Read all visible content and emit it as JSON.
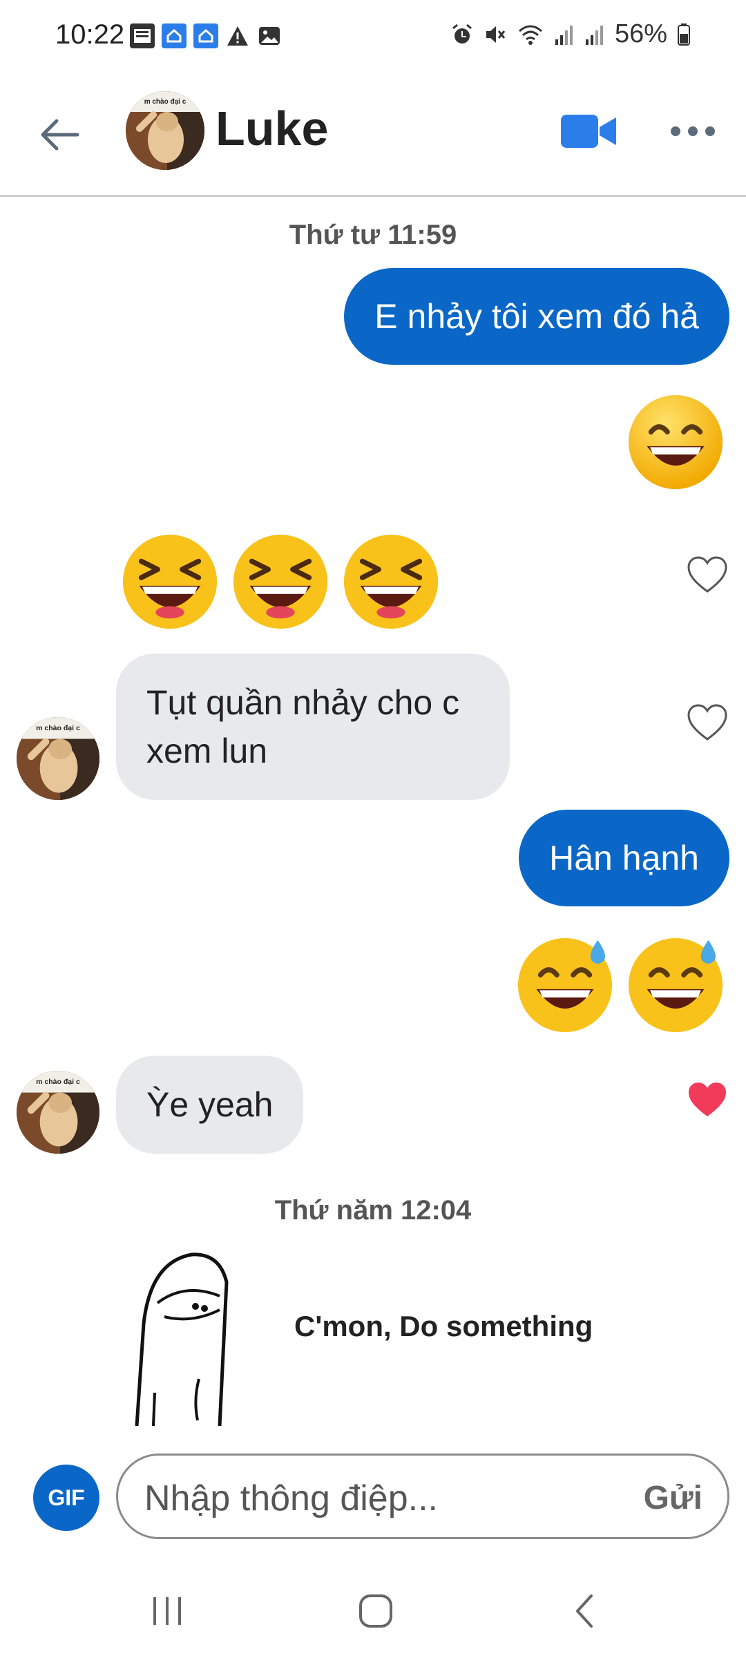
{
  "status_bar": {
    "time": "10:22",
    "battery": "56%",
    "left_icons": [
      "bao-moi-icon",
      "notification-icon",
      "notification-icon",
      "warning-icon",
      "image-icon"
    ],
    "right_icons": [
      "alarm-icon",
      "mute-icon",
      "wifi-icon",
      "signal-icon",
      "signal-icon",
      "battery-icon"
    ]
  },
  "header": {
    "contact_name": "Luke",
    "avatar_caption": "m chào đại c",
    "accent_color": "#2b7de9"
  },
  "conversation": {
    "timestamp_1": "Thứ tư 11:59",
    "msg_out_1": "E nhảy tôi xem đó hả",
    "emoji_out_1": [
      "😁"
    ],
    "emoji_in_1": [
      "😆",
      "😆",
      "😆"
    ],
    "msg_in_1": "Tụt quần nhảy cho c xem lun",
    "msg_out_2": "Hân hạnh",
    "emoji_out_2": [
      "😅",
      "😅"
    ],
    "msg_in_2": "Ỳe yeah",
    "timestamp_2": "Thứ năm 12:04",
    "sticker_text": "C'mon, Do something"
  },
  "composer": {
    "gif_label": "GIF",
    "placeholder": "Nhập thông điệp...",
    "send_label": "Gửi"
  },
  "colors": {
    "outgoing_bubble": "#0a67c7",
    "incoming_bubble": "#e8e9ec",
    "heart_liked": "#f23a5a"
  }
}
